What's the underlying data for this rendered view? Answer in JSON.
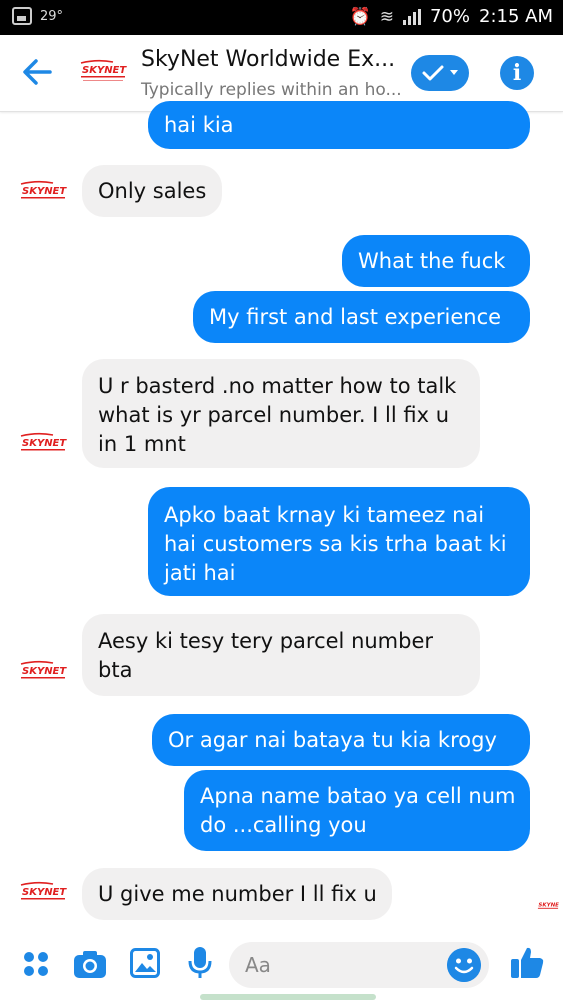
{
  "status_bar": {
    "temperature": "29°",
    "battery": "70%",
    "time": "2:15 AM"
  },
  "header": {
    "title": "SkyNet Worldwide Ex...",
    "subtitle": "Typically replies within an ho...",
    "logo_text": "SKYNET"
  },
  "messages": [
    {
      "from": "me",
      "text": "hai kia"
    },
    {
      "from": "them",
      "text": "Only sales"
    },
    {
      "from": "me",
      "text": "What the fuck"
    },
    {
      "from": "me",
      "text": "My first and last experience"
    },
    {
      "from": "them",
      "text": "U r basterd .no matter how to talk   what is yr parcel number. I ll fix u in 1 mnt"
    },
    {
      "from": "me",
      "text": "Apko baat krnay ki tameez nai hai customers sa kis trha baat ki jati hai"
    },
    {
      "from": "them",
      "text": "Aesy ki tesy tery    parcel number bta"
    },
    {
      "from": "me",
      "text": "Or agar nai bataya tu kia krogy"
    },
    {
      "from": "me",
      "text": "Apna name batao ya cell num do ...calling you"
    },
    {
      "from": "them",
      "text": "U give me number I ll fix u"
    }
  ],
  "composer": {
    "placeholder": "Aa"
  },
  "colors": {
    "accent": "#1e88e5",
    "outgoing_bubble": "#0b86f9",
    "incoming_bubble": "#f1f0f0",
    "logo_red": "#e02020"
  },
  "icons": [
    "back-arrow-icon",
    "checkmark-icon",
    "chevron-down-icon",
    "info-icon",
    "apps-icon",
    "camera-icon",
    "image-icon",
    "microphone-icon",
    "emoji-icon",
    "thumbs-up-icon"
  ]
}
